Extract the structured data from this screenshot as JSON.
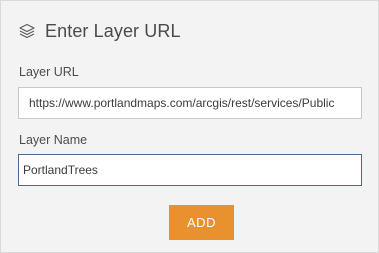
{
  "header": {
    "icon": "layers-icon",
    "title": "Enter Layer URL"
  },
  "form": {
    "url_label": "Layer URL",
    "url_value": "https://www.portlandmaps.com/arcgis/rest/services/Public",
    "name_label": "Layer Name",
    "name_value": "PortlandTrees"
  },
  "actions": {
    "add_label": "ADD"
  },
  "colors": {
    "accent": "#e8912e",
    "focus_border": "#4a6c8a",
    "panel_bg": "#f3f3f3"
  }
}
